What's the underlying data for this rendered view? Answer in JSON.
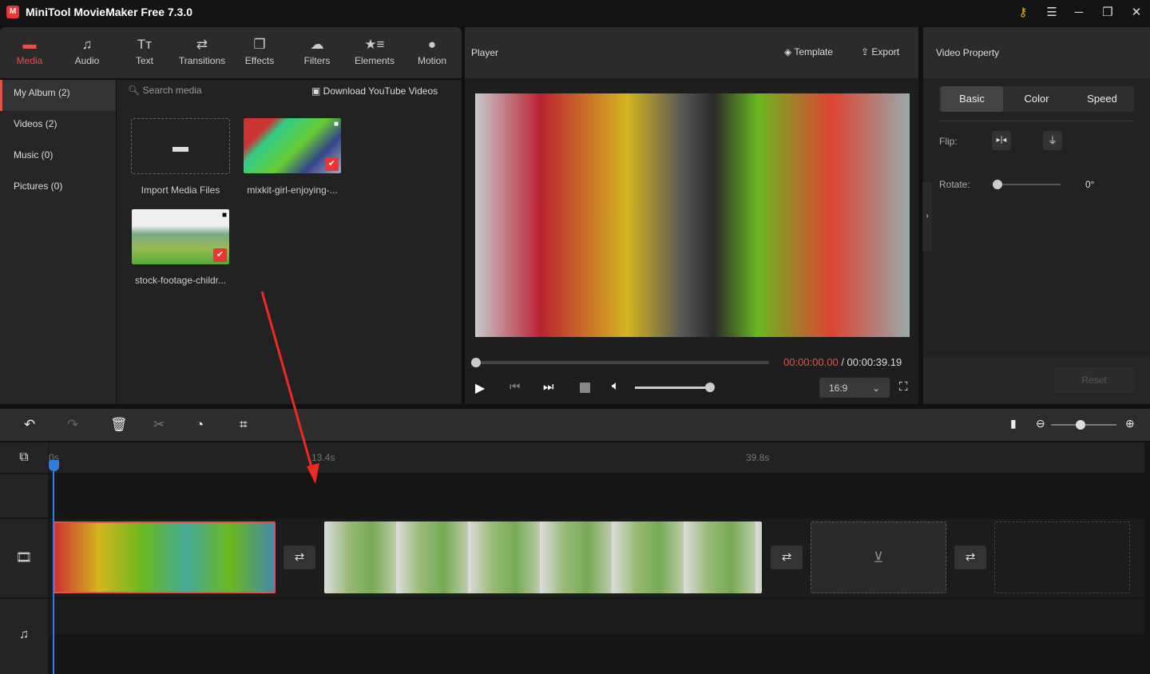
{
  "app": {
    "title": "MiniTool MovieMaker Free 7.3.0"
  },
  "tabs": [
    {
      "label": "Media",
      "icon": "folder-icon"
    },
    {
      "label": "Audio",
      "icon": "music-note-icon"
    },
    {
      "label": "Text",
      "icon": "text-icon"
    },
    {
      "label": "Transitions",
      "icon": "swap-icon"
    },
    {
      "label": "Effects",
      "icon": "layers-icon"
    },
    {
      "label": "Filters",
      "icon": "filters-icon"
    },
    {
      "label": "Elements",
      "icon": "star-list-icon"
    },
    {
      "label": "Motion",
      "icon": "motion-icon"
    }
  ],
  "sidebar": {
    "items": [
      {
        "label": "My Album (2)"
      },
      {
        "label": "Videos (2)"
      },
      {
        "label": "Music (0)"
      },
      {
        "label": "Pictures (0)"
      }
    ]
  },
  "media": {
    "search_placeholder": "Search media",
    "download_label": "Download YouTube Videos",
    "items": [
      {
        "caption": "Import Media Files"
      },
      {
        "caption": "mixkit-girl-enjoying-..."
      },
      {
        "caption": "stock-footage-childr..."
      }
    ]
  },
  "player": {
    "title": "Player",
    "template_label": "Template",
    "export_label": "Export",
    "current_time": "00:00:00.00",
    "total_time": "/ 00:00:39.19",
    "aspect": "16:9",
    "progress": 0,
    "volume": 1.0
  },
  "property": {
    "title": "Video Property",
    "tabs": [
      "Basic",
      "Color",
      "Speed"
    ],
    "active_tab": "Basic",
    "flip_label": "Flip:",
    "rotate_label": "Rotate:",
    "rotate_value": "0°",
    "reset_label": "Reset"
  },
  "timeline": {
    "ticks": [
      "0s",
      "13.4s",
      "39.8s"
    ],
    "zoom": 0.6
  },
  "colors": {
    "accent": "#e0524a",
    "playhead": "#2f7de1"
  }
}
